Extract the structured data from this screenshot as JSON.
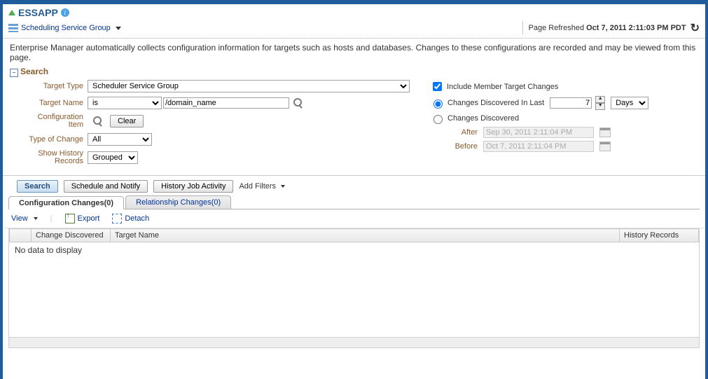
{
  "header": {
    "app_title": "ESSAPP",
    "breadcrumb": "Scheduling Service Group",
    "page_refreshed_label": "Page Refreshed",
    "page_refreshed_time": "Oct 7, 2011 2:11:03 PM PDT"
  },
  "intro": "Enterprise Manager automatically collects configuration information for targets such as hosts and databases. Changes to these configurations are recorded and may be viewed from this page.",
  "search": {
    "title": "Search",
    "target_type_label": "Target Type",
    "target_type_value": "Scheduler Service Group",
    "target_name_label": "Target Name",
    "target_name_op": "is",
    "target_name_value": "/domain_name",
    "config_item_label": "Configuration Item",
    "clear_button": "Clear",
    "type_of_change_label": "Type of Change",
    "type_of_change_value": "All",
    "show_history_label": "Show History Records",
    "show_history_value": "Grouped",
    "include_member_label": "Include Member Target Changes",
    "discovered_last_label": "Changes Discovered In Last",
    "discovered_last_value": "7",
    "discovered_last_unit": "Days",
    "discovered_label": "Changes Discovered",
    "after_label": "After",
    "after_value": "Sep 30, 2011 2:11:04 PM",
    "before_label": "Before",
    "before_value": "Oct 7, 2011 2:11:04 PM"
  },
  "actions": {
    "search": "Search",
    "schedule": "Schedule and Notify",
    "history": "History Job Activity",
    "add_filters": "Add Filters"
  },
  "tabs": {
    "config": "Configuration Changes(0)",
    "relationship": "Relationship Changes(0)"
  },
  "toolbar": {
    "view": "View",
    "export": "Export",
    "detach": "Detach"
  },
  "table": {
    "col_change": "Change Discovered",
    "col_target": "Target Name",
    "col_history": "History Records",
    "no_data": "No data to display"
  }
}
